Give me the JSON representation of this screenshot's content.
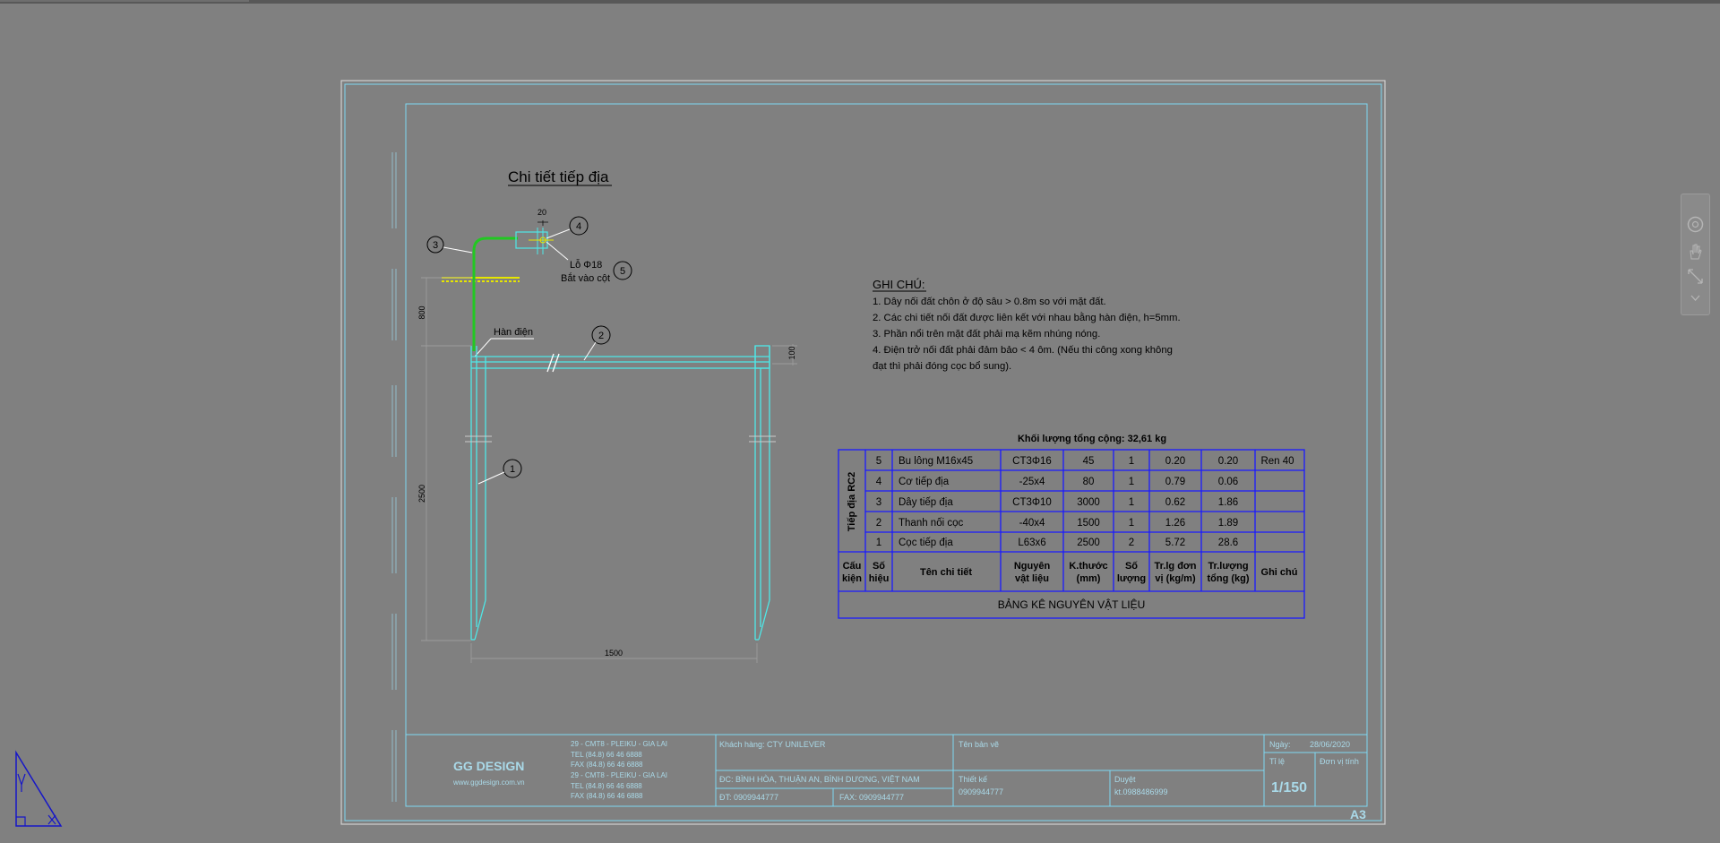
{
  "drawing": {
    "title": "Chi tiết tiếp địa",
    "callouts": [
      "1",
      "2",
      "3",
      "4",
      "5"
    ],
    "hole_label": "Lỗ Φ18",
    "bolt_label": "Bắt vào cột",
    "weld_label": "Hàn điện",
    "dim_20": "20",
    "dim_800": "800",
    "dim_100": "100",
    "dim_2500": "2500",
    "dim_1500": "1500"
  },
  "notes": {
    "heading": "GHI CHÚ:",
    "line1": "1. Dây nối đất chôn ở độ sâu > 0.8m so với mặt đất.",
    "line2": "2. Các chi tiết nối đất được liên kết với nhau bằng hàn điện, h=5mm.",
    "line3": "3. Phần nổi trên mặt đất phải mạ kẽm nhúng nóng.",
    "line4a": "4. Điện trở nối đất phải đảm bảo < 4 ôm. (Nếu thi công xong không",
    "line4b": "đạt thì phải đóng cọc bổ sung)."
  },
  "table": {
    "total": "Khối lượng tổng cộng: 32,61 kg",
    "group_label": "Tiếp địa RC2",
    "rows": [
      {
        "no": "5",
        "name": "Bu lông M16x45",
        "material": "CT3Φ16",
        "size": "45",
        "qty": "1",
        "unit_w": "0.20",
        "total_w": "0.20",
        "note": "Ren 40"
      },
      {
        "no": "4",
        "name": "Cơ tiếp địa",
        "material": "-25x4",
        "size": "80",
        "qty": "1",
        "unit_w": "0.79",
        "total_w": "0.06",
        "note": ""
      },
      {
        "no": "3",
        "name": "Dây tiếp địa",
        "material": "CT3Φ10",
        "size": "3000",
        "qty": "1",
        "unit_w": "0.62",
        "total_w": "1.86",
        "note": ""
      },
      {
        "no": "2",
        "name": "Thanh nối cọc",
        "material": "-40x4",
        "size": "1500",
        "qty": "1",
        "unit_w": "1.26",
        "total_w": "1.89",
        "note": ""
      },
      {
        "no": "1",
        "name": "Cọc tiếp địa",
        "material": "L63x6",
        "size": "2500",
        "qty": "2",
        "unit_w": "5.72",
        "total_w": "28.6",
        "note": ""
      }
    ],
    "headers": {
      "cau_kien": [
        "Cấu",
        "kiện"
      ],
      "so_hieu": [
        "Số",
        "hiệu"
      ],
      "ten": "Tên chi tiết",
      "nguyen": [
        "Nguyên",
        "vật liệu"
      ],
      "kthuoc": [
        "K.thước",
        "(mm)"
      ],
      "soluong": [
        "Số",
        "lượng"
      ],
      "trlg": [
        "Tr.lg đơn",
        "vị (kg/m)"
      ],
      "trluong": [
        "Tr.lượng",
        "tổng (kg)"
      ],
      "ghichu": "Ghi chú"
    },
    "caption": "BẢNG KÊ NGUYÊN VẬT LIỆU"
  },
  "titleblock": {
    "logo": "GG DESIGN",
    "website": "www.ggdesign.com.vn",
    "addr1": "29 - CMT8 - PLEIKU - GIA LAI",
    "tel1": "TEL   (84.8) 66 46 6888",
    "fax1": "FAX   (84.8) 66 46 6888",
    "addr2": "29 - CMT8 - PLEIKU - GIA LAI",
    "tel2": "TEL   (84.8) 66 46 6888",
    "fax2": "FAX   (84.8) 66 46 6888",
    "client": "Khách hàng:  CTY UNILEVER",
    "address": "ĐC:  BÌNH HÒA, THUẬN AN, BÌNH DƯƠNG, VIỆT NAM",
    "phone": "ĐT:  0909944777",
    "fax": "FAX:  0909944777",
    "drawing_name": "Tên bản vẽ",
    "designer": "Thiết kế",
    "designer_phone": "0909944777",
    "approver": "Duyệt",
    "approver_phone": "kt.0988486999",
    "date_label": "Ngày:",
    "date": "28/06/2020",
    "scale_label": "Tỉ lệ",
    "scale": "1/150",
    "unit_label": "Đơn vị tính",
    "sheet_size": "A3"
  },
  "colors": {
    "background": "#808080",
    "frame": "#7ed8f2",
    "cyan": "#4ee8e8",
    "green": "#22c822",
    "yellow": "#e6e600",
    "table_border": "#1a1aff",
    "text": "#000000"
  }
}
